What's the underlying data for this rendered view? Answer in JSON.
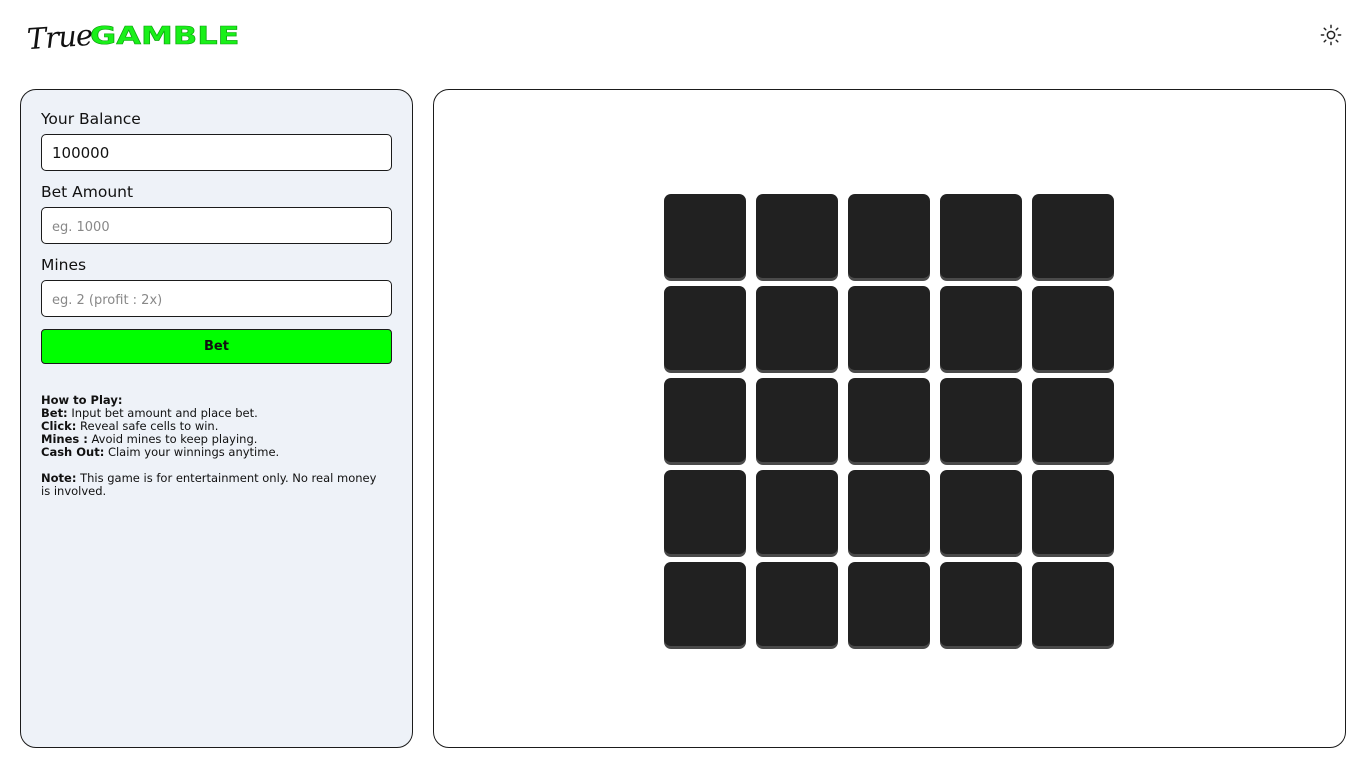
{
  "header": {
    "logo_true": "True",
    "logo_gamble": "GAMBLE",
    "theme_icon": "sun-icon",
    "brand_color": "#19f019"
  },
  "sidebar": {
    "balance_label": "Your Balance",
    "balance_value": "100000",
    "bet_label": "Bet Amount",
    "bet_placeholder": "eg. 1000",
    "mines_label": "Mines",
    "mines_placeholder": "eg. 2 (profit : 2x)",
    "bet_button": "Bet",
    "bet_button_color": "#00ff00",
    "howto_title": "How to Play:",
    "howto": [
      {
        "term": "Bet:",
        "text": " Input bet amount and place bet."
      },
      {
        "term": "Click:",
        "text": " Reveal safe cells to win."
      },
      {
        "term": "Mines :",
        "text": " Avoid mines to keep playing."
      },
      {
        "term": "Cash Out:",
        "text": " Claim your winnings anytime."
      }
    ],
    "note_term": "Note:",
    "note_text": " This game is for entertainment only. No real money is involved."
  },
  "board": {
    "rows": 5,
    "cols": 5,
    "cell_color": "#212121"
  }
}
